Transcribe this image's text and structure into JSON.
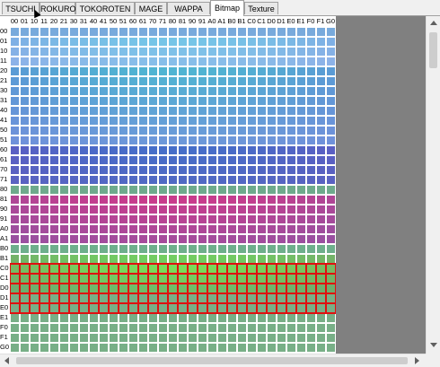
{
  "tabs": [
    {
      "label": "TSUCHI",
      "active": false
    },
    {
      "label": "ROKURO",
      "active": false
    },
    {
      "label": "TOKOROTEN",
      "active": false
    },
    {
      "label": "MAGE",
      "active": false
    },
    {
      "label": "WAPPA",
      "active": false
    },
    {
      "label": "Bitmap",
      "active": true
    },
    {
      "label": "Texture",
      "active": false
    }
  ],
  "grid": {
    "column_labels": [
      "00",
      "01",
      "10",
      "11",
      "20",
      "21",
      "30",
      "31",
      "40",
      "41",
      "50",
      "51",
      "60",
      "61",
      "70",
      "71",
      "80",
      "81",
      "90",
      "91",
      "A0",
      "A1",
      "B0",
      "B1",
      "C0",
      "C1",
      "D0",
      "D1",
      "E0",
      "E1",
      "F0",
      "F1",
      "G0"
    ],
    "row_labels": [
      "00",
      "01",
      "10",
      "11",
      "20",
      "21",
      "30",
      "31",
      "40",
      "41",
      "50",
      "51",
      "60",
      "61",
      "70",
      "71",
      "80",
      "81",
      "90",
      "91",
      "A0",
      "A1",
      "B0",
      "B1",
      "C0",
      "C1",
      "D0",
      "D1",
      "E0",
      "E1",
      "F0",
      "F1",
      "G0"
    ],
    "selected_rows": [
      "C0",
      "C1",
      "D0",
      "D1",
      "E0"
    ],
    "selection_color": "#e01010",
    "empty_area_color": "#808080"
  }
}
